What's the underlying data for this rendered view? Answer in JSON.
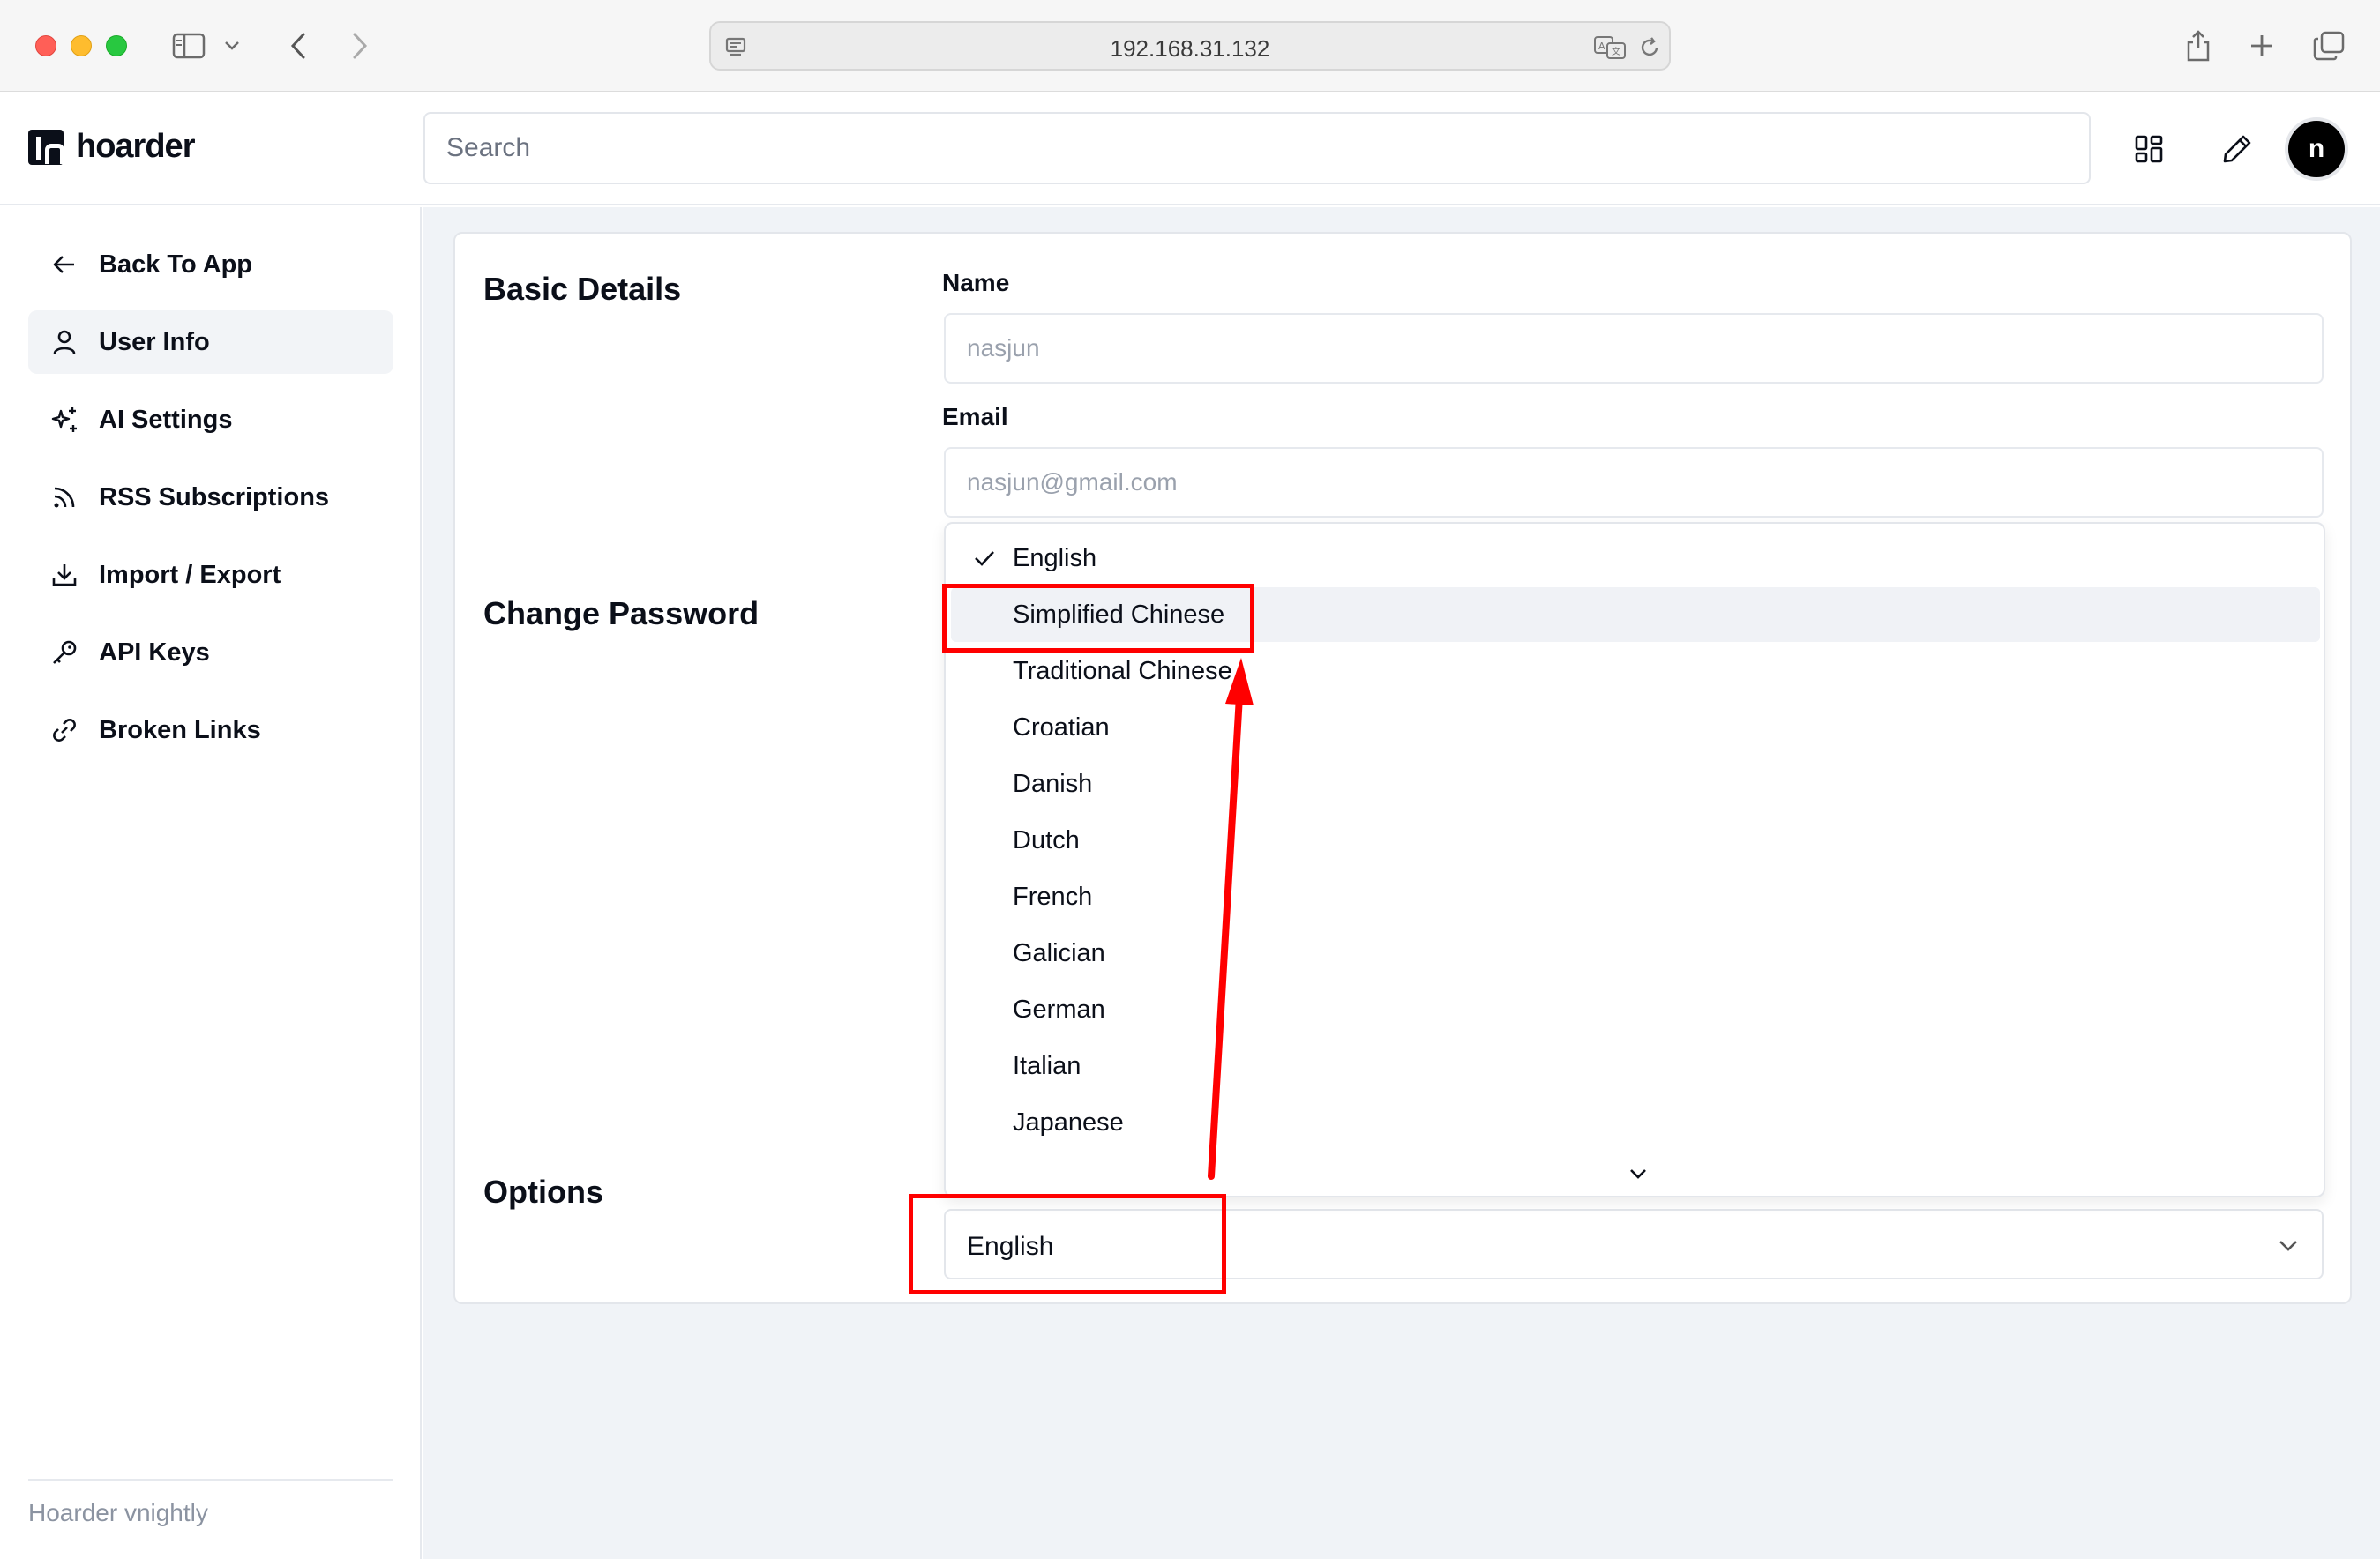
{
  "browser": {
    "url": "192.168.31.132"
  },
  "header": {
    "logo_text": "hoarder",
    "search_placeholder": "Search",
    "avatar_initial": "n"
  },
  "sidebar": {
    "items": [
      {
        "label": "Back To App",
        "icon": "arrow-left-icon"
      },
      {
        "label": "User Info",
        "icon": "user-icon",
        "active": true
      },
      {
        "label": "AI Settings",
        "icon": "sparkles-icon"
      },
      {
        "label": "RSS Subscriptions",
        "icon": "rss-icon"
      },
      {
        "label": "Import / Export",
        "icon": "download-icon"
      },
      {
        "label": "API Keys",
        "icon": "key-icon"
      },
      {
        "label": "Broken Links",
        "icon": "link-icon"
      }
    ],
    "footer": "Hoarder vnightly"
  },
  "main": {
    "basic_details_title": "Basic Details",
    "name_label": "Name",
    "name_value": "nasjun",
    "email_label": "Email",
    "email_value": "nasjun@gmail.com",
    "change_password_title": "Change Password",
    "options_title": "Options",
    "language_select_value": "English"
  },
  "language_dropdown": {
    "selected": "English",
    "highlighted": "Simplified Chinese",
    "options": [
      "English",
      "Simplified Chinese",
      "Traditional Chinese",
      "Croatian",
      "Danish",
      "Dutch",
      "French",
      "Galician",
      "German",
      "Italian",
      "Japanese"
    ]
  },
  "colors": {
    "annotation": "#ff0000",
    "brand_dark": "#0b0f19",
    "page_bg": "#f0f3f7"
  }
}
